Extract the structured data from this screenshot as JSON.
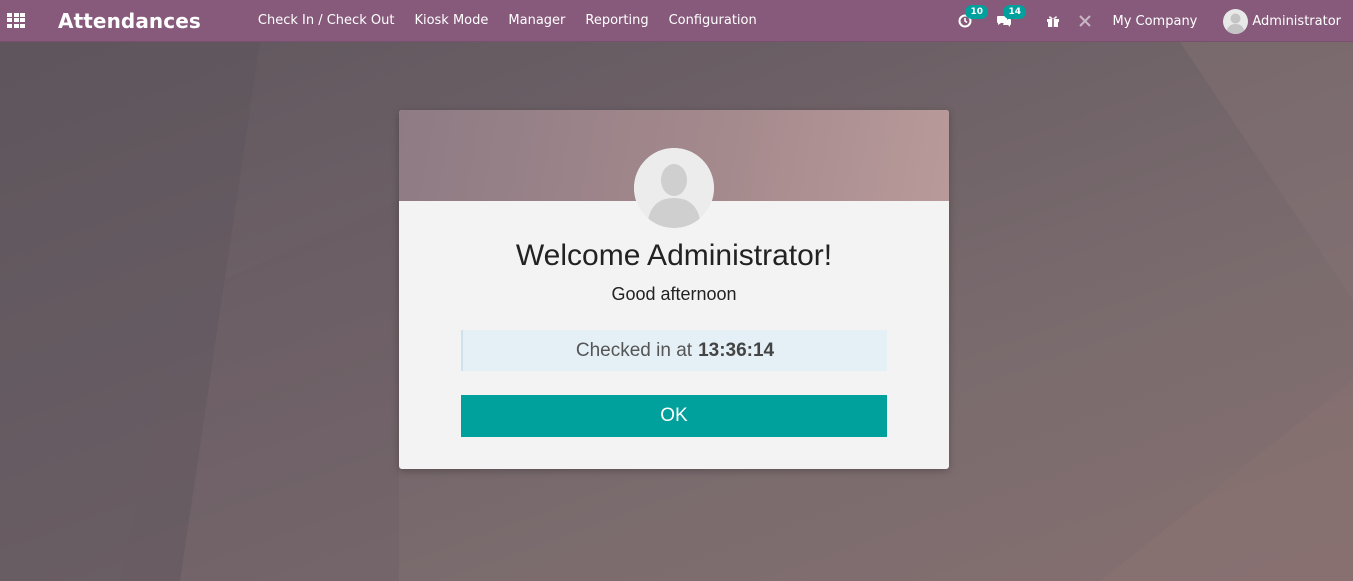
{
  "navbar": {
    "app_title": "Attendances",
    "menu": [
      {
        "label": "Check In / Check Out"
      },
      {
        "label": "Kiosk Mode"
      },
      {
        "label": "Manager"
      },
      {
        "label": "Reporting"
      },
      {
        "label": "Configuration"
      }
    ],
    "activity_count": "10",
    "messages_count": "14",
    "company": "My Company",
    "user": "Administrator"
  },
  "dialog": {
    "title": "Welcome Administrator!",
    "greeting": "Good afternoon",
    "checked_in_prefix": "Checked in at",
    "checked_in_time": "13:36:14",
    "ok_label": "OK"
  },
  "colors": {
    "navbar": "#875a7b",
    "accent": "#00a09d"
  },
  "icons": [
    "apps-grid-icon",
    "activity-clock-icon",
    "chat-icon",
    "gift-icon",
    "debug-tools-icon",
    "user-avatar-icon"
  ]
}
